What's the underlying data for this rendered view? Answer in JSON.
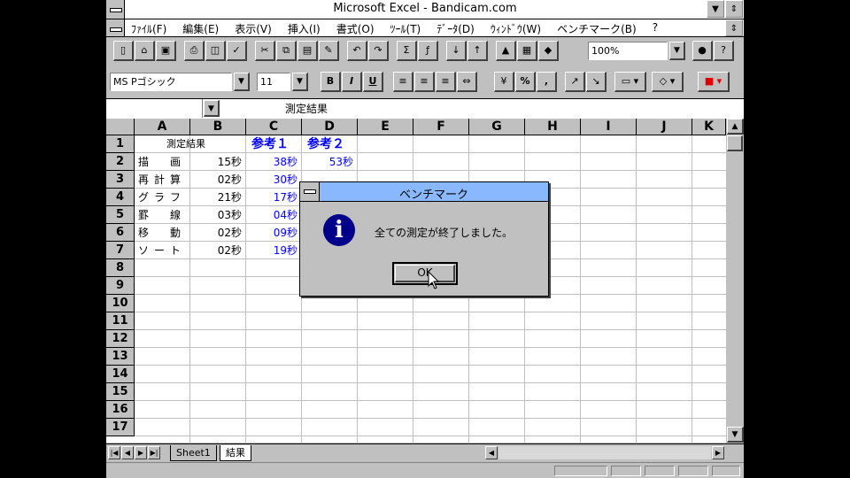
{
  "window": {
    "title": "Microsoft Excel - Bandicam.com"
  },
  "menu": [
    "ﾌｧｲﾙ(F)",
    "編集(E)",
    "表示(V)",
    "挿入(I)",
    "書式(O)",
    "ﾂｰﾙ(T)",
    "ﾃﾞｰﾀ(D)",
    "ｳｨﾝﾄﾞｳ(W)",
    "ベンチマーク(B)",
    "?"
  ],
  "toolbar": {
    "zoom": "100%",
    "font_name": "MS Pゴシック",
    "font_size": "11",
    "bold_label": "B",
    "italic_label": "I",
    "underline_label": "U",
    "percent_label": "%",
    "comma_label": ","
  },
  "formula_bar": {
    "cell_ref": "",
    "content": "測定結果"
  },
  "columns": [
    "A",
    "B",
    "C",
    "D",
    "E",
    "F",
    "G",
    "H",
    "I",
    "J",
    "K"
  ],
  "rows": [
    "1",
    "2",
    "3",
    "4",
    "5",
    "6",
    "7",
    "8",
    "9",
    "10",
    "11",
    "12",
    "13",
    "14",
    "15",
    "16",
    "17"
  ],
  "cells": {
    "header_a": "測定結果",
    "header_c": "参考１",
    "header_d": "参考２",
    "rows": [
      {
        "label": "描　画",
        "b": "15秒",
        "c": "38秒",
        "d": "53秒"
      },
      {
        "label": "再計算",
        "b": "02秒",
        "c": "30秒",
        "d": ""
      },
      {
        "label": "グラフ",
        "b": "21秒",
        "c": "17秒",
        "d": ""
      },
      {
        "label": "罫　線",
        "b": "03秒",
        "c": "04秒",
        "d": ""
      },
      {
        "label": "移　動",
        "b": "02秒",
        "c": "09秒",
        "d": ""
      },
      {
        "label": "ソート",
        "b": "02秒",
        "c": "19秒",
        "d": ""
      }
    ]
  },
  "sheets": {
    "tab1": "Sheet1",
    "tab2": "結果"
  },
  "dialog": {
    "title": "ベンチマーク",
    "message": "全ての測定が終了しました。",
    "ok_label": "OK",
    "icon": "information-icon"
  },
  "colors": {
    "dialog_title": "#8ab8ff",
    "cell_blue": "#0000ff",
    "face": "#c0c0c0"
  }
}
